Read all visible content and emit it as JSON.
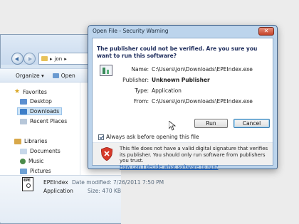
{
  "explorer": {
    "address_text": "jon",
    "toolbar": {
      "organize_label": "Organize ▾",
      "open_label": "Open"
    },
    "sidebar": {
      "favorites_label": "Favorites",
      "favorites_items": [
        "Desktop",
        "Downloads",
        "Recent Places"
      ],
      "libraries_label": "Libraries",
      "libraries_items": [
        "Documents",
        "Music",
        "Pictures"
      ]
    },
    "details": {
      "icon_text": "EPE",
      "file_name": "EPEIndex",
      "date_modified": "Date modified: 7/26/2011 7:50 PM",
      "type_label": "Application",
      "size": "Size: 470 KB"
    }
  },
  "dialog": {
    "title": "Open File - Security Warning",
    "close_label": "✕",
    "heading": "The publisher could not be verified.  Are you sure you want to run this software?",
    "fields": {
      "name_label": "Name:",
      "name_value": "C:\\Users\\jon\\Downloads\\EPEIndex.exe",
      "publisher_label": "Publisher:",
      "publisher_value": "Unknown Publisher",
      "type_label": "Type:",
      "type_value": "Application",
      "from_label": "From:",
      "from_value": "C:\\Users\\jon\\Downloads\\EPEIndex.exe"
    },
    "run_label": "Run",
    "cancel_label": "Cancel",
    "checkbox_label": "Always ask before opening this file",
    "checkbox_checked": true,
    "warning_text": "This file does not have a valid digital signature that verifies its publisher.  You should only run software from publishers you trust.",
    "warning_link": "How can I decide what software to run?"
  },
  "colors": {
    "dialog_frame": "#bcd4ec",
    "close_button": "#c5432a",
    "heading_text": "#1b2a5a",
    "link": "#1a5db8",
    "selected_item": "#cde4f7"
  }
}
